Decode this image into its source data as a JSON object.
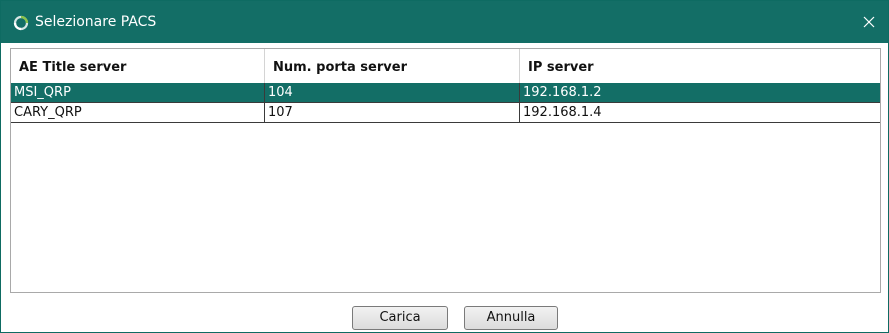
{
  "window": {
    "title": "Selezionare PACS",
    "icon": "refresh-ring-icon",
    "close_icon": "close-icon"
  },
  "grid": {
    "columns": [
      "AE Title server",
      "Num. porta server",
      "IP server"
    ],
    "rows": [
      {
        "ae_title": "MSI_QRP",
        "port": "104",
        "ip": "192.168.1.2",
        "selected": true
      },
      {
        "ae_title": "CARY_QRP",
        "port": "107",
        "ip": "192.168.1.4",
        "selected": false
      }
    ]
  },
  "buttons": {
    "load_label": "Carica",
    "cancel_label": "Annulla"
  },
  "colors": {
    "accent": "#136e66",
    "selected_text": "#ffffff"
  }
}
